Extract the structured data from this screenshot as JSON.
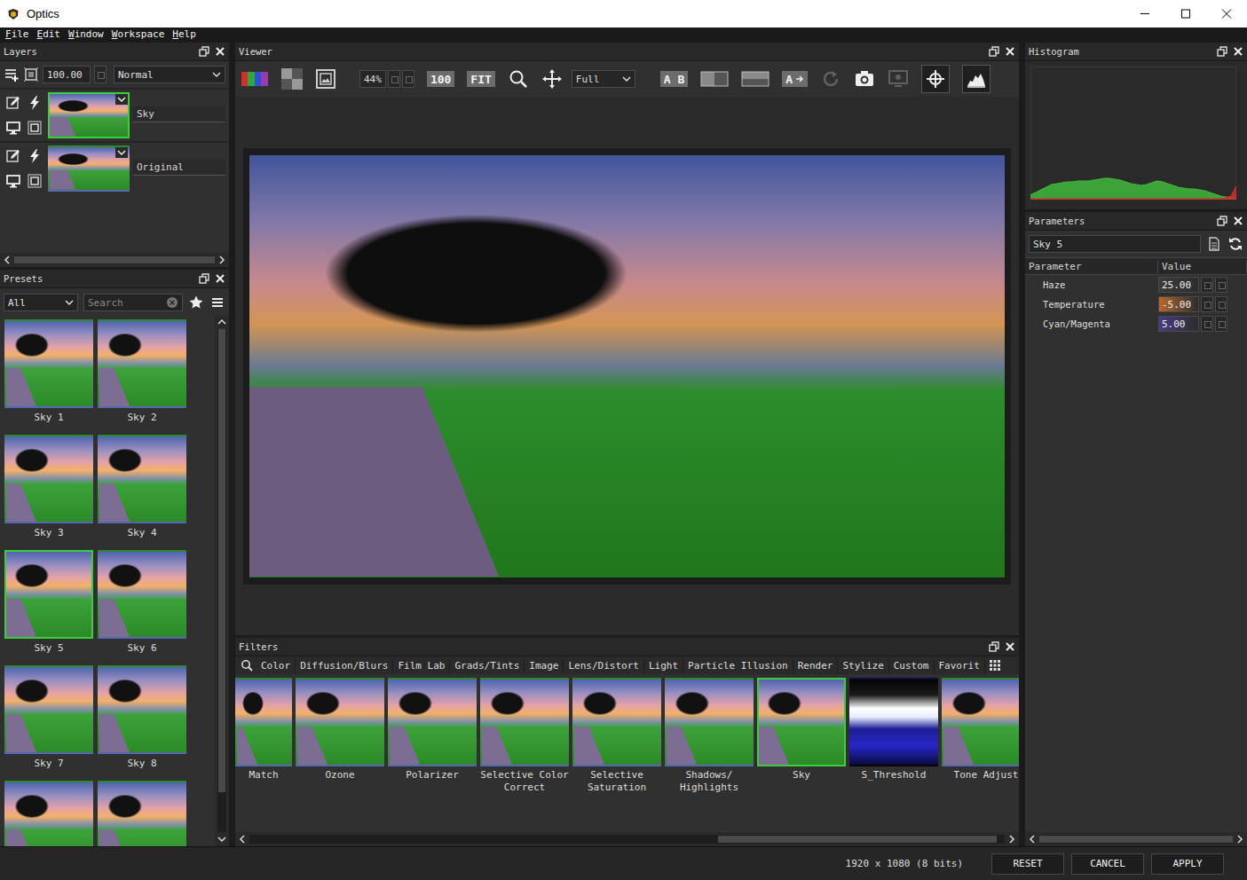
{
  "window": {
    "title": "Optics"
  },
  "menu": [
    {
      "label": "File"
    },
    {
      "label": "Edit"
    },
    {
      "label": "Window"
    },
    {
      "label": "Workspace"
    },
    {
      "label": "Help"
    }
  ],
  "layers": {
    "title": "Layers",
    "opacity": "100.00",
    "blend_mode": "Normal",
    "items": [
      {
        "name": "Sky",
        "selected": true
      },
      {
        "name": "Original",
        "selected": false
      }
    ]
  },
  "presets": {
    "title": "Presets",
    "category": "All",
    "search_placeholder": "Search",
    "items": [
      {
        "label": "Sky 1",
        "selected": false
      },
      {
        "label": "Sky 2",
        "selected": false
      },
      {
        "label": "Sky 3",
        "selected": false
      },
      {
        "label": "Sky 4",
        "selected": false
      },
      {
        "label": "Sky 5",
        "selected": true
      },
      {
        "label": "Sky 6",
        "selected": false
      },
      {
        "label": "Sky 7",
        "selected": false
      },
      {
        "label": "Sky 8",
        "selected": false
      },
      {
        "label": "",
        "selected": false
      },
      {
        "label": "",
        "selected": false
      }
    ]
  },
  "viewer": {
    "title": "Viewer",
    "zoom": "44%",
    "actual_size": "100",
    "fit": "FIT",
    "view_mode": "Full",
    "ab_compare": "A B",
    "single_view": "A",
    "reset_view_disabled": true,
    "monitor_snapshot_disabled": true,
    "crosshair_on": true,
    "histogram_on": true
  },
  "histogram": {
    "title": "Histogram",
    "series": [
      {
        "name": "Green",
        "color": "#3fb83c",
        "values": [
          5,
          8,
          11,
          14,
          17,
          18,
          19,
          20,
          20,
          21,
          21,
          21,
          22,
          23,
          24,
          24,
          23,
          22,
          20,
          18,
          17,
          16,
          17,
          19,
          21,
          20,
          18,
          16,
          14,
          13,
          12,
          12,
          11,
          10,
          8,
          6,
          4,
          3,
          2,
          2
        ]
      },
      {
        "name": "Red",
        "color": "#d42a2a",
        "values": [
          1,
          1,
          1,
          1,
          1,
          1,
          1,
          1,
          1,
          1,
          1,
          1,
          1,
          1,
          1,
          1,
          1,
          1,
          1,
          1,
          1,
          1,
          1,
          1,
          1,
          1,
          1,
          1,
          1,
          1,
          1,
          1,
          1,
          1,
          1,
          1,
          1,
          2,
          4,
          15
        ]
      }
    ]
  },
  "parameters": {
    "title": "Parameters",
    "preset_name": "Sky 5",
    "columns": [
      "Parameter",
      "Value"
    ],
    "rows": [
      {
        "name": "Haze",
        "value": "25.00",
        "color": "#3c3c3c"
      },
      {
        "name": "Temperature",
        "value": "-5.00",
        "color": "#b8692a"
      },
      {
        "name": "Cyan/Magenta",
        "value": "5.00",
        "color": "#4b3a86"
      }
    ]
  },
  "filters": {
    "title": "Filters",
    "tabs": [
      {
        "label": "Color",
        "selected": false
      },
      {
        "label": "Diffusion/Blurs",
        "selected": false
      },
      {
        "label": "Film Lab",
        "selected": false
      },
      {
        "label": "Grads/Tints",
        "selected": false
      },
      {
        "label": "Image",
        "selected": false
      },
      {
        "label": "Lens/Distort",
        "selected": false
      },
      {
        "label": "Light",
        "selected": false
      },
      {
        "label": "Particle Illusion",
        "selected": false
      },
      {
        "label": "Render",
        "selected": false
      },
      {
        "label": "Stylize",
        "selected": false
      },
      {
        "label": "Custom",
        "selected": false
      },
      {
        "label": "Favorit",
        "selected": false
      }
    ],
    "items": [
      {
        "label": "Match",
        "selected": false,
        "kind": "photo"
      },
      {
        "label": "Ozone",
        "selected": false,
        "kind": "photo"
      },
      {
        "label": "Polarizer",
        "selected": false,
        "kind": "photo"
      },
      {
        "label": "Selective Color Correct",
        "selected": false,
        "kind": "photo"
      },
      {
        "label": "Selective Saturation",
        "selected": false,
        "kind": "photo"
      },
      {
        "label": "Shadows/ Highlights",
        "selected": false,
        "kind": "photo"
      },
      {
        "label": "Sky",
        "selected": true,
        "kind": "photo"
      },
      {
        "label": "S_Threshold",
        "selected": false,
        "kind": "threshold"
      },
      {
        "label": "Tone Adjust",
        "selected": false,
        "kind": "photo"
      }
    ]
  },
  "status_bar": {
    "resolution": "1920 x 1080 (8 bits)",
    "buttons": [
      {
        "label": "RESET"
      },
      {
        "label": "CANCEL"
      },
      {
        "label": "APPLY"
      }
    ]
  }
}
